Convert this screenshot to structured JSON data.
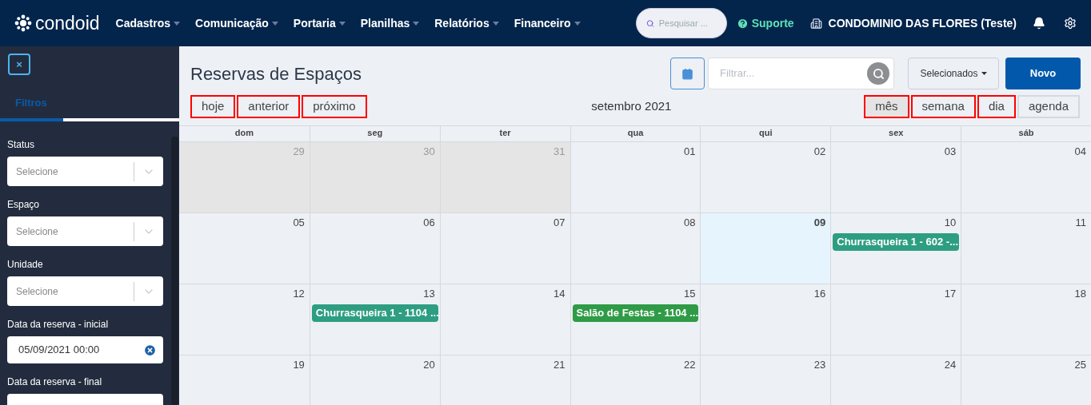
{
  "navbar": {
    "logo": "condoid",
    "menu": [
      {
        "label": "Cadastros"
      },
      {
        "label": "Comunicação"
      },
      {
        "label": "Portaria"
      },
      {
        "label": "Planilhas"
      },
      {
        "label": "Relatórios"
      },
      {
        "label": "Financeiro"
      }
    ],
    "search": {
      "placeholder": "Pesquisar ..."
    },
    "support": "Suporte",
    "condominium": "CONDOMINIO DAS FLORES (Teste)"
  },
  "sidebar": {
    "close": "×",
    "tabs": [
      {
        "label": "Filtros",
        "selected": true
      }
    ],
    "filters": [
      {
        "kind": "select",
        "label": "Status",
        "placeholder": "Selecione"
      },
      {
        "kind": "select",
        "label": "Espaço",
        "placeholder": "Selecione"
      },
      {
        "kind": "select",
        "label": "Unidade",
        "placeholder": "Selecione"
      },
      {
        "kind": "date",
        "label": "Data da reserva - inicial",
        "value": "05/09/2021 00:00"
      },
      {
        "kind": "date",
        "label": "Data da reserva - final"
      }
    ]
  },
  "page": {
    "title": "Reservas de Espaços",
    "filter": {
      "placeholder": "Filtrar..."
    },
    "dropdown": "Selecionados",
    "new_button": "Novo"
  },
  "toolbar": {
    "nav": [
      {
        "label": "hoje",
        "highlighted": true
      },
      {
        "label": "anterior",
        "highlighted": true
      },
      {
        "label": "próximo",
        "highlighted": true
      }
    ],
    "month": "setembro 2021",
    "views": [
      {
        "label": "mês",
        "selected": true,
        "highlighted": true
      },
      {
        "label": "semana",
        "selected": false,
        "highlighted": true
      },
      {
        "label": "dia",
        "selected": false,
        "highlighted": true
      },
      {
        "label": "agenda",
        "selected": false,
        "highlighted": false
      }
    ]
  },
  "calendar": {
    "weekdays": [
      "dom",
      "seg",
      "ter",
      "qua",
      "qui",
      "sex",
      "sáb"
    ],
    "weeks": [
      [
        {
          "day": "29",
          "other_month": true,
          "today": false
        },
        {
          "day": "30",
          "other_month": true,
          "today": false
        },
        {
          "day": "31",
          "other_month": true,
          "today": false
        },
        {
          "day": "01",
          "other_month": false,
          "today": false
        },
        {
          "day": "02",
          "other_month": false,
          "today": false
        },
        {
          "day": "03",
          "other_month": false,
          "today": false
        },
        {
          "day": "04",
          "other_month": false,
          "today": false
        }
      ],
      [
        {
          "day": "05",
          "other_month": false,
          "today": false
        },
        {
          "day": "06",
          "other_month": false,
          "today": false
        },
        {
          "day": "07",
          "other_month": false,
          "today": false
        },
        {
          "day": "08",
          "other_month": false,
          "today": false
        },
        {
          "day": "09",
          "other_month": false,
          "today": true
        },
        {
          "day": "10",
          "other_month": false,
          "today": false,
          "events": [
            {
              "title": "Churrasqueira 1 - 602 -...",
              "color": "#2e9e82"
            }
          ]
        },
        {
          "day": "11",
          "other_month": false,
          "today": false
        }
      ],
      [
        {
          "day": "12",
          "other_month": false,
          "today": false
        },
        {
          "day": "13",
          "other_month": false,
          "today": false,
          "events": [
            {
              "title": "Churrasqueira 1 - 1104 ...",
              "color": "#2e9e82"
            }
          ]
        },
        {
          "day": "14",
          "other_month": false,
          "today": false
        },
        {
          "day": "15",
          "other_month": false,
          "today": false,
          "events": [
            {
              "title": "Salão de Festas - 1104 ...",
              "color": "#2f9b46"
            }
          ]
        },
        {
          "day": "16",
          "other_month": false,
          "today": false
        },
        {
          "day": "17",
          "other_month": false,
          "today": false
        },
        {
          "day": "18",
          "other_month": false,
          "today": false
        }
      ],
      [
        {
          "day": "19",
          "other_month": false,
          "today": false
        },
        {
          "day": "20",
          "other_month": false,
          "today": false
        },
        {
          "day": "21",
          "other_month": false,
          "today": false
        },
        {
          "day": "22",
          "other_month": false,
          "today": false
        },
        {
          "day": "23",
          "other_month": false,
          "today": false
        },
        {
          "day": "24",
          "other_month": false,
          "today": false
        },
        {
          "day": "25",
          "other_month": false,
          "today": false
        }
      ]
    ]
  }
}
